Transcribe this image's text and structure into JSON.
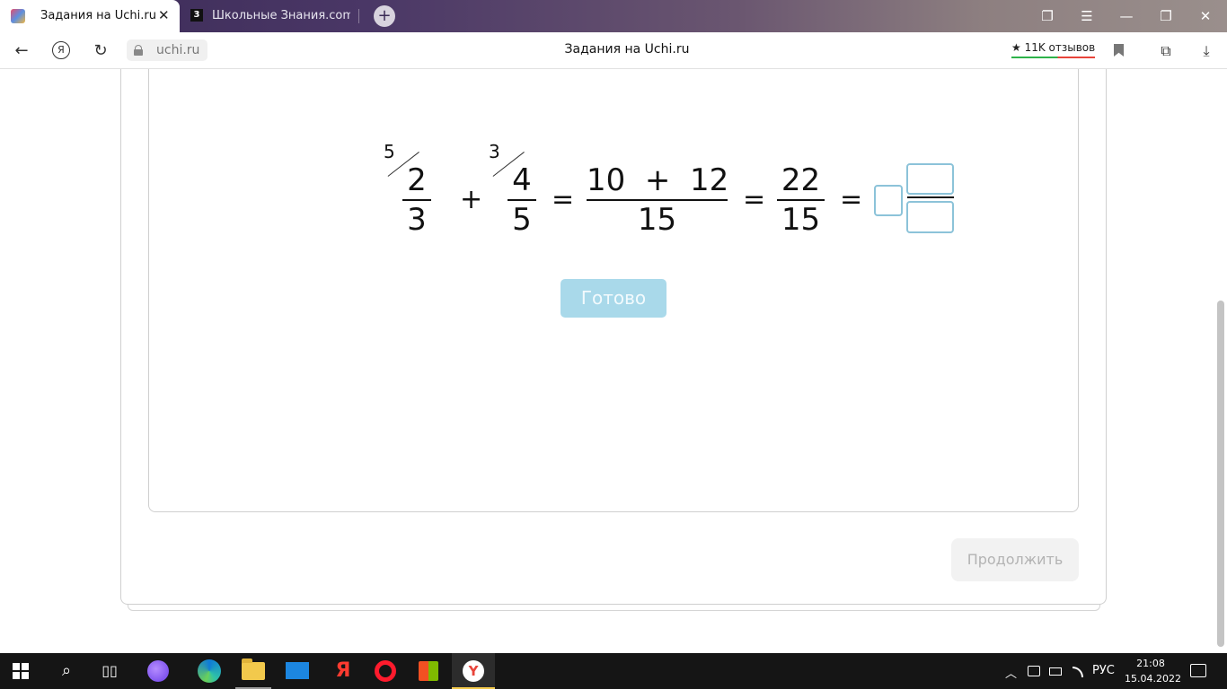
{
  "browser": {
    "active_tab": {
      "title": "Задания на Uchi.ru",
      "close": "✕"
    },
    "second_tab": {
      "badge": "3",
      "title": "Школьные Знания.com - Р"
    },
    "new_tab": "+",
    "window_controls": {
      "collections": "❐",
      "menu": "☰",
      "minimize": "—",
      "restore": "❐",
      "close": "✕"
    },
    "nav": {
      "back": "←",
      "yandex": "Я",
      "reload": "↻"
    },
    "url": "uchi.ru",
    "page_title": "Задания на Uchi.ru",
    "reviews": "★ 11K отзывов",
    "tools": {
      "extensions": "⧉",
      "download": "⤓"
    }
  },
  "exercise": {
    "fraction1": {
      "numerator": "2",
      "denominator": "3",
      "factor": "5"
    },
    "fraction2": {
      "numerator": "4",
      "denominator": "5",
      "factor": "3"
    },
    "plus": "+",
    "equals": "=",
    "sum": {
      "numerator": "10  +  12",
      "denominator": "15"
    },
    "result": {
      "numerator": "22",
      "denominator": "15"
    },
    "ready_button": "Готово",
    "continue_button": "Продолжить"
  },
  "taskbar": {
    "search": "⌕",
    "task_view": "▯▯",
    "yandex": "Я",
    "ybrowser": "Y",
    "tray": {
      "chevron": "︿",
      "lang": "РУС"
    },
    "time": "21:08",
    "date": "15.04.2022"
  }
}
